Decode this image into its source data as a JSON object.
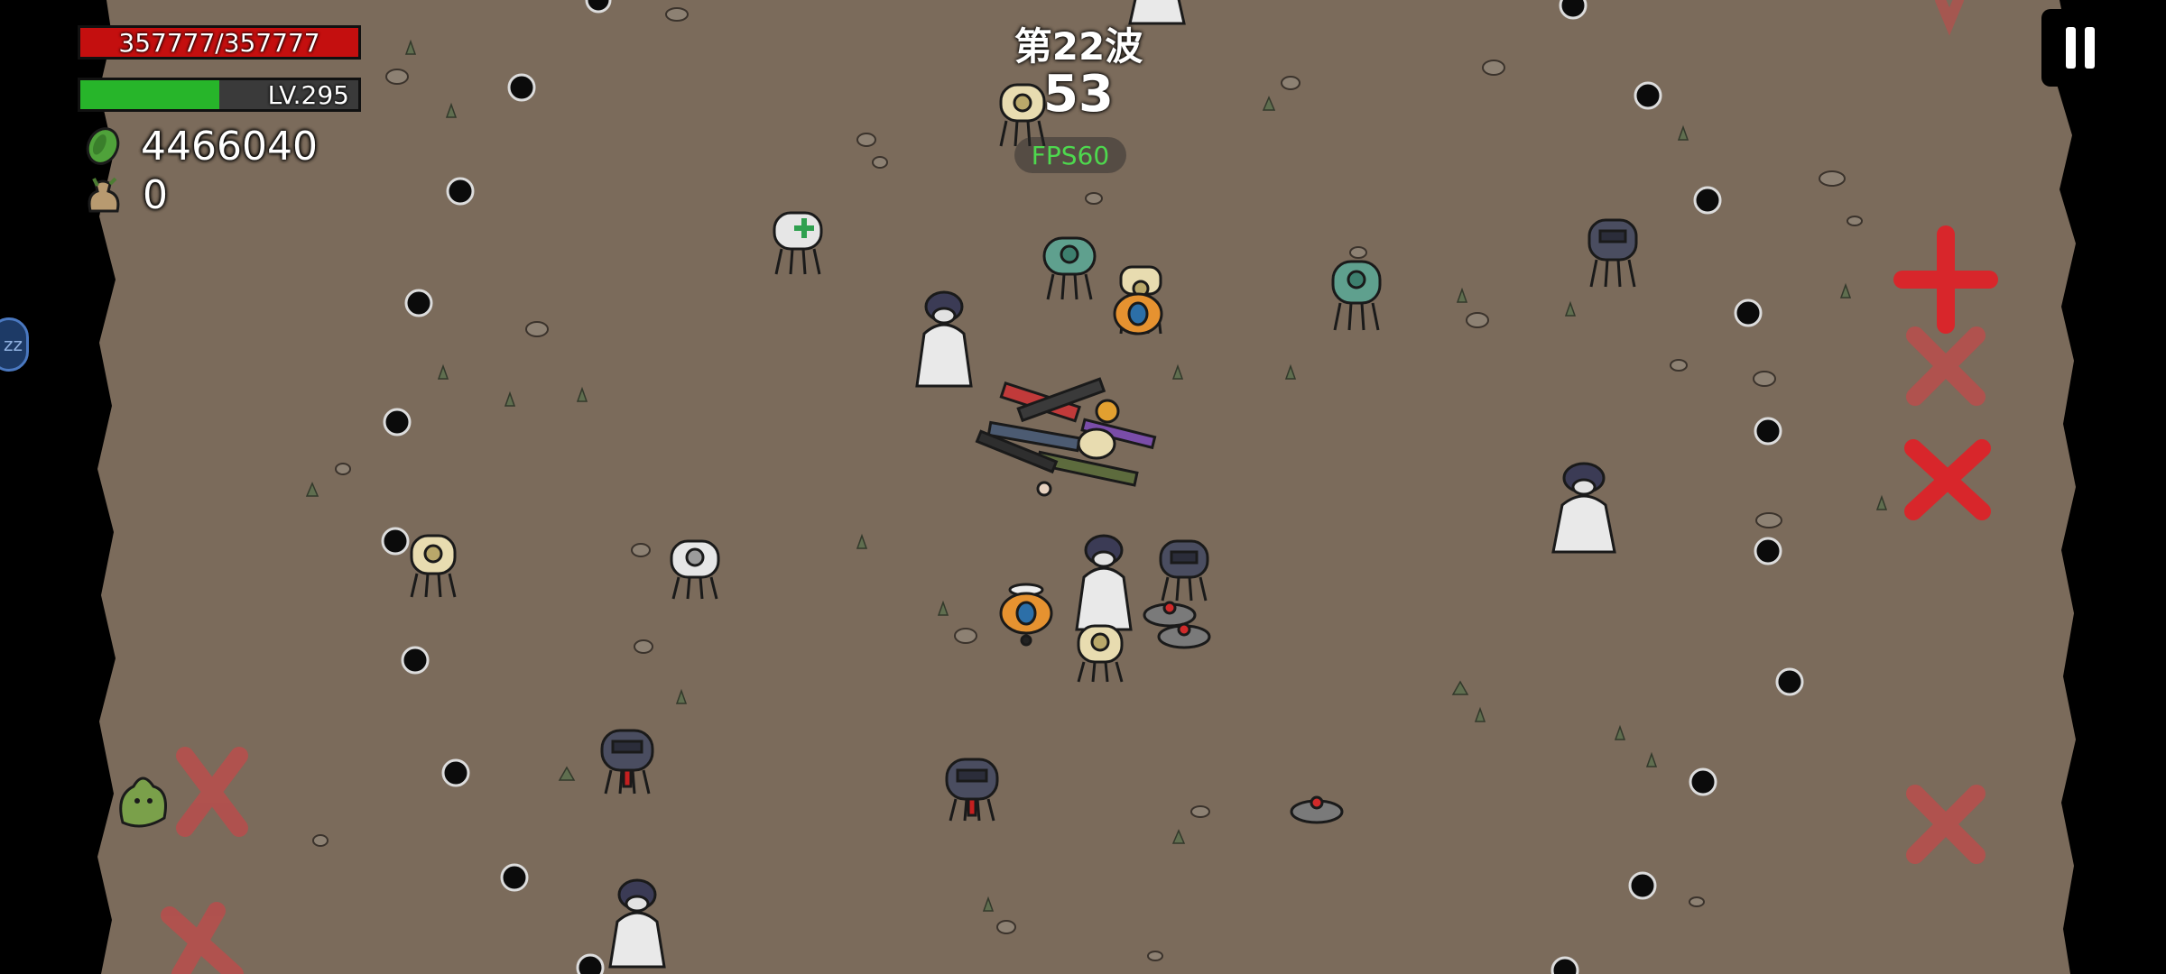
{
  "hud": {
    "hp_text": "357777/357777",
    "hp_fraction": 1.0,
    "level_text": "LV.295",
    "xp_fraction": 0.5,
    "coins": "4466040",
    "bags": "0"
  },
  "wave": {
    "label": "第22波",
    "countdown": "53"
  },
  "fps_label": "FPS60",
  "side_badge": "zz",
  "colors": {
    "ground": "#7a6a5a",
    "hp": "#c40f0f",
    "xp": "#27b52a",
    "fps": "#4ed84e"
  },
  "icons": {
    "pause": "pause-icon",
    "coin": "coin-icon",
    "bag": "loot-bag-icon"
  }
}
